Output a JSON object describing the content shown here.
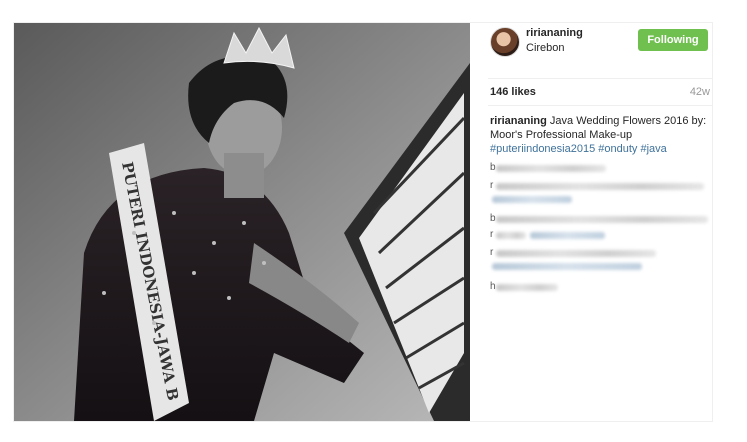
{
  "post": {
    "header": {
      "username": "ririananing",
      "location": "Cirebon",
      "follow_label": "Following"
    },
    "stats": {
      "likes": "146 likes",
      "age": "42w"
    },
    "caption": {
      "username": "ririananing",
      "text": "Java Wedding Flowers 2016 by: Moor's Professional Make-up",
      "hashtags": [
        "#puteriindonesia2015",
        "#onduty",
        "#java"
      ]
    },
    "comments": [
      {
        "initial": "b"
      },
      {
        "initial": "r"
      },
      {
        "initial": "b"
      },
      {
        "initial": "r"
      },
      {
        "initial": "r"
      },
      {
        "initial": "h"
      }
    ],
    "photo": {
      "sash_text": "PUTERI INDONESIA-JAWA B"
    }
  },
  "colors": {
    "follow_button": "#70c050",
    "hashtag": "#3f729b"
  }
}
